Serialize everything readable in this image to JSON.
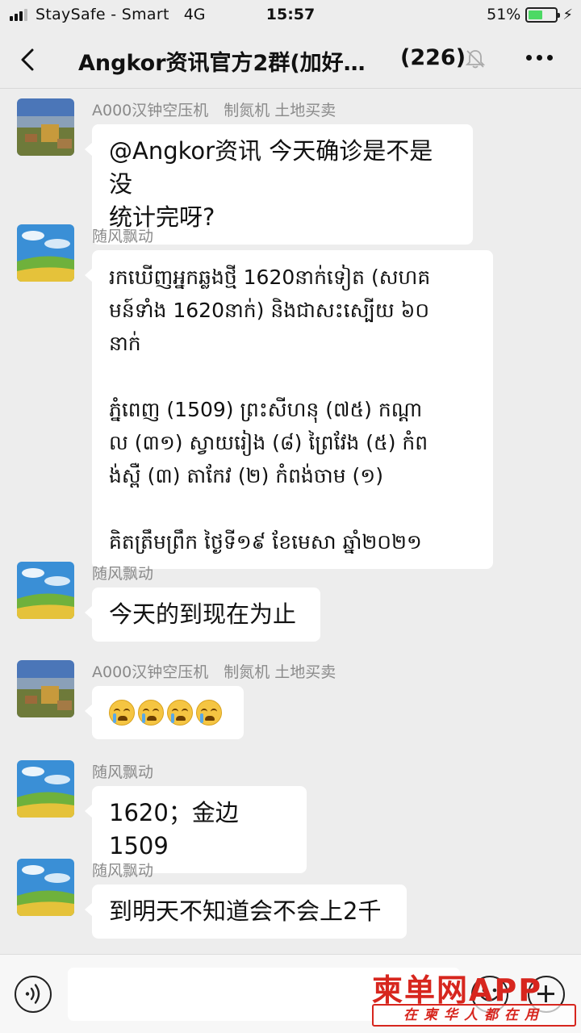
{
  "status_bar": {
    "carrier": "StaySafe - Smart",
    "network": "4G",
    "time": "15:57",
    "battery_percent": "51%",
    "battery_level": 0.51
  },
  "header": {
    "title": "Angkor资讯官方2群(加好…",
    "member_count": "(226)"
  },
  "messages": [
    {
      "sender": "A000汉钟空压机　制氮机 土地买卖",
      "avatar": "landscape-town",
      "lines": [
        "@Angkor资讯 今天确诊是不是没",
        "统计完呀?"
      ]
    },
    {
      "sender": "随风飘动",
      "avatar": "sky-field",
      "lines": [
        "រកឃើញអ្នកឆ្លងថ្មី 1620នាក់ទៀត (សហគ",
        "មន៍ទាំង 1620នាក់) និងជាសះស្បើយ ៦០",
        "នាក់",
        "",
        "ភ្នំពេញ (1509) ព្រះសីហនុ (៧៥) កណ្តា",
        "ល (៣១) ស្វាយរៀង (៨) ព្រៃវែង (៥) កំព",
        "ង់ស្ពឺ (៣) តាកែវ (២) កំពង់ចាម (១)",
        "",
        "គិតត្រឹមព្រឹក ថ្ងៃទី១៩ ខែមេសា ឆ្នាំ២០២១"
      ]
    },
    {
      "sender": "随风飘动",
      "avatar": "sky-field",
      "text": "今天的到现在为止"
    },
    {
      "sender": "A000汉钟空压机　制氮机 土地买卖",
      "avatar": "landscape-town",
      "emoji": [
        "crying-face",
        "crying-face",
        "crying-face",
        "crying-face"
      ]
    },
    {
      "sender": "随风飘动",
      "avatar": "sky-field",
      "text": "1620；金边1509"
    },
    {
      "sender": "随风飘动",
      "avatar": "sky-field",
      "text": "到明天不知道会不会上2千"
    }
  ],
  "input_bar": {
    "placeholder": ""
  },
  "watermark": {
    "logo": "柬单网APP",
    "tagline": "在柬华人都在用"
  },
  "colors": {
    "background": "#ededed",
    "bubble": "#ffffff",
    "watermark_red": "#d7261e",
    "battery_green": "#4cd964"
  }
}
